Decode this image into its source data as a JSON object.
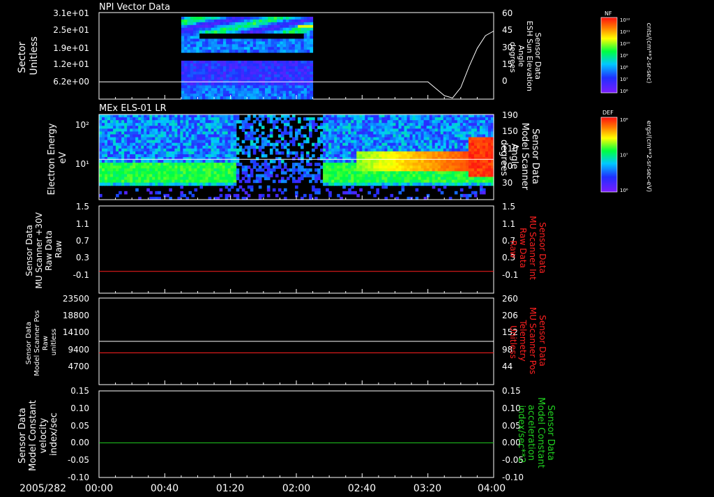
{
  "colors": {
    "background": "#000000",
    "axis": "#ffffff",
    "trace_white": "#ffffff",
    "trace_red": "#ff2020",
    "trace_green": "#20d020"
  },
  "time_axis": {
    "date_label": "2005/282",
    "ticks": [
      "00:00",
      "00:40",
      "01:20",
      "02:00",
      "02:40",
      "03:20",
      "04:00"
    ],
    "range_minutes": [
      0,
      240
    ]
  },
  "chart_data": [
    {
      "type": "heatmap",
      "title": "NPI Vector Data",
      "left_axis": {
        "label_lines": [
          "Sector",
          "Unitless"
        ],
        "ticks": [
          "3.1e+01",
          "2.5e+01",
          "1.9e+01",
          "1.2e+01",
          "6.2e+00"
        ]
      },
      "right_axis": {
        "label_lines": [
          "Sensor Data",
          "ESH Sun Elevation",
          "Angle",
          "degrees"
        ],
        "ticks": [
          "60",
          "45",
          "30",
          "15",
          "0"
        ],
        "range": [
          -15,
          60
        ]
      },
      "data_window_minutes": [
        50,
        130
      ],
      "colorbar": {
        "label": "NF",
        "units": "cnts/(cm**2-sr-sec)",
        "ticks": [
          "10¹²",
          "10¹¹",
          "10¹⁰",
          "10⁹",
          "10⁸",
          "10⁷",
          "10⁶"
        ]
      },
      "overlay_trace": {
        "name": "Sensor Data ESH Sun Elevation Angle",
        "x_minutes": [
          0,
          200,
          205,
          210,
          215,
          220,
          225,
          230,
          235,
          240
        ],
        "y": [
          0,
          0,
          -6,
          -12,
          -14,
          -5,
          13,
          29,
          40,
          44
        ]
      }
    },
    {
      "type": "heatmap",
      "title": "MEx ELS-01 LR",
      "left_axis": {
        "label_lines": [
          "Electron Energy",
          "eV"
        ],
        "ticks": [
          "10²",
          "10¹"
        ]
      },
      "right_axis": {
        "label_lines": [
          "Sensor Data",
          "Model Scanner",
          "Angle",
          "degrees"
        ],
        "ticks": [
          "190",
          "150",
          "110",
          "70",
          "30"
        ],
        "range": [
          0,
          190
        ]
      },
      "colorbar": {
        "label": "DEF",
        "units": "ergs/(cm**2-sr-sec-eV)",
        "ticks": [
          "10⁸",
          "10⁷",
          "10⁶"
        ]
      },
      "overlay_trace": {
        "name": "Sensor Data Model Scanner Angle",
        "x_minutes": [
          0,
          240
        ],
        "y": [
          90,
          90
        ]
      }
    },
    {
      "type": "line",
      "left_axis": {
        "label_lines": [
          "Sensor Data",
          "MU Scanner +30V",
          "Raw Data",
          "Raw"
        ],
        "ticks": [
          "1.5",
          "1.1",
          "0.7",
          "0.3",
          "-0.1"
        ],
        "range": [
          -0.5,
          1.5
        ]
      },
      "right_axis": {
        "label_lines": [
          "Sensor Data",
          "MU Scanner Int",
          "Raw Data",
          "Raw"
        ],
        "ticks": [
          "1.5",
          "1.1",
          "0.7",
          "0.3",
          "-0.1"
        ],
        "range": [
          -0.5,
          1.5
        ]
      },
      "series": [
        {
          "x_minutes": [
            0,
            240
          ],
          "y": [
            0.0,
            0.0
          ]
        }
      ]
    },
    {
      "type": "line",
      "left_axis": {
        "label_lines": [
          "Sensor Data",
          "Model Scanner Pos",
          "Raw",
          "unitless"
        ],
        "ticks": [
          "23500",
          "18800",
          "14100",
          "9400",
          "4700"
        ],
        "range": [
          0,
          23500
        ]
      },
      "right_axis": {
        "label_lines": [
          "Sensor Data",
          "MU Scanner Pos",
          "Telemetry",
          "Unitless"
        ],
        "ticks": [
          "260",
          "206",
          "152",
          "98",
          "44"
        ],
        "range": [
          -10,
          260
        ]
      },
      "series": [
        {
          "x_minutes": [
            0,
            240
          ],
          "y": [
            11750,
            11750
          ]
        },
        {
          "x_minutes": [
            0,
            240
          ],
          "y": [
            89,
            89
          ]
        }
      ]
    },
    {
      "type": "line",
      "left_axis": {
        "label_lines": [
          "Sensor Data",
          "Model Constant",
          "velocity",
          "index/sec"
        ],
        "ticks": [
          "0.15",
          "0.10",
          "0.05",
          "0.00",
          "-0.05",
          "-0.10"
        ],
        "range": [
          -0.1,
          0.15
        ]
      },
      "right_axis": {
        "label_lines": [
          "Sensor Data",
          "Model Constant",
          "acceleration",
          "index/sec**2"
        ],
        "ticks": [
          "0.15",
          "0.10",
          "0.05",
          "0.00",
          "-0.05",
          "-0.10"
        ],
        "range": [
          -0.1,
          0.15
        ]
      },
      "series": [
        {
          "x_minutes": [
            0,
            240
          ],
          "y": [
            0.0,
            0.0
          ]
        }
      ]
    }
  ]
}
